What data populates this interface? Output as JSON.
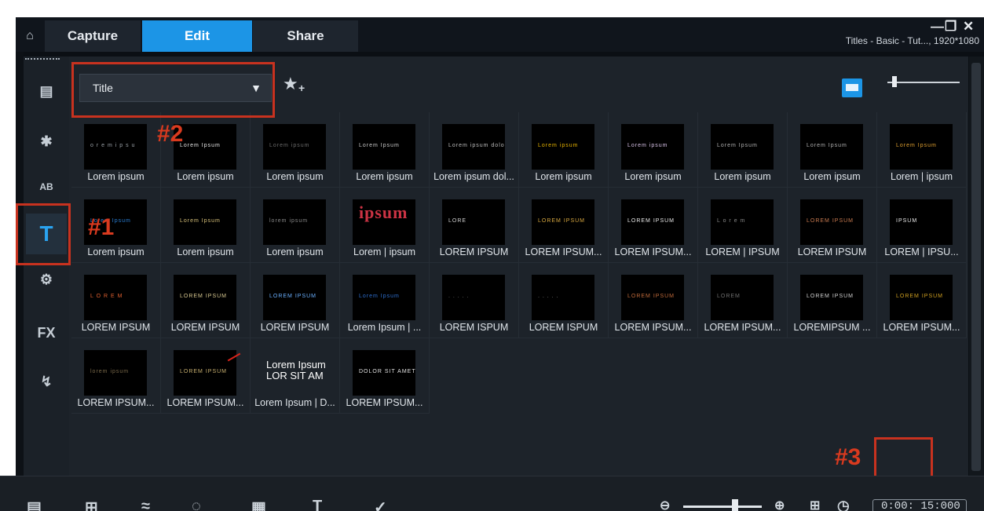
{
  "window": {
    "title": "Titles - Basic - Tut..., 1920*1080",
    "minimize_glyph": "—",
    "restore_glyph": "❐",
    "close_glyph": "✕"
  },
  "tabs": [
    {
      "label": "Capture"
    },
    {
      "label": "Edit",
      "active": true
    },
    {
      "label": "Share"
    }
  ],
  "sidebar": {
    "items": [
      {
        "name": "media-library-icon",
        "glyph": "▤"
      },
      {
        "name": "instant-project-icon",
        "glyph": "✱"
      },
      {
        "name": "transition-icon",
        "glyph": "AB"
      },
      {
        "name": "title-icon",
        "glyph": "T",
        "active": true
      },
      {
        "name": "graphics-icon",
        "glyph": "⚙"
      },
      {
        "name": "filter-icon",
        "glyph": "FX"
      },
      {
        "name": "path-icon",
        "glyph": "↯"
      }
    ]
  },
  "toolbar": {
    "category_value": "Title",
    "favorite_glyph": "★"
  },
  "colors": {
    "accent": "#1c95e6",
    "annotation_red": "#c8321f",
    "panel_bg": "#1d232a"
  },
  "annotations": {
    "label1": "#1",
    "label2": "#2",
    "label3": "#3"
  },
  "thumbnails": [
    {
      "caption": "Lorem ipsum",
      "art": "o r e m   i p s u",
      "color": "#9aa0a6"
    },
    {
      "caption": "Lorem ipsum",
      "art": "Lorem Ipsum",
      "color": "#e6e6e6"
    },
    {
      "caption": "Lorem ipsum",
      "art": "Lorem ipsum",
      "color": "#6b6b6b"
    },
    {
      "caption": "Lorem ipsum",
      "art": "Lorem Ipsum",
      "color": "#c9c9c9"
    },
    {
      "caption": "Lorem ipsum dol...",
      "art": "Lorem ipsum dolor sit",
      "color": "#bdbdbd"
    },
    {
      "caption": "Lorem ipsum",
      "art": "Lorem ipsum",
      "color": "#e8b400"
    },
    {
      "caption": "Lorem ipsum",
      "art": "Lorem ipsum",
      "color": "#d9c3e8"
    },
    {
      "caption": "Lorem ipsum",
      "art": "Lorem Ipsum",
      "color": "#b0b0b0"
    },
    {
      "caption": "Lorem ipsum",
      "art": "Lorem Ipsum",
      "color": "#b0b0b0"
    },
    {
      "caption": "Lorem | ipsum",
      "art": "Lorem Ipsum",
      "color": "#e0a030"
    },
    {
      "caption": "Lorem ipsum",
      "art": "Lorem Ipsum",
      "color": "#2a7fd6"
    },
    {
      "caption": "Lorem ipsum",
      "art": "Lorem Ipsum",
      "color": "#d9c27a"
    },
    {
      "caption": "Lorem ipsum",
      "art": "lorem ipsum",
      "color": "#8a8a8a"
    },
    {
      "caption": "Lorem | ipsum",
      "art": "ipsum",
      "color": "#cc3344"
    },
    {
      "caption": "LOREM IPSUM",
      "art": "LORE",
      "color": "#cfcfcf"
    },
    {
      "caption": "LOREM IPSUM...",
      "art": "LOREM IPSUM",
      "color": "#d8a840"
    },
    {
      "caption": "LOREM IPSUM...",
      "art": "LOREM IPSUM",
      "color": "#e8e8e8"
    },
    {
      "caption": "LOREM | IPSUM",
      "art": "L o r e m",
      "color": "#888888"
    },
    {
      "caption": "LOREM IPSUM",
      "art": "LOREM IPSUM",
      "color": "#c87a50"
    },
    {
      "caption": "LOREM | IPSU...",
      "art": "IPSUM",
      "color": "#e8e8e8"
    },
    {
      "caption": "LOREM IPSUM",
      "art": "L O R E M",
      "color": "#e06030"
    },
    {
      "caption": "LOREM IPSUM",
      "art": "LOREM IPSUM",
      "color": "#d8c890"
    },
    {
      "caption": "LOREM IPSUM",
      "art": "LOREM IPSUM",
      "color": "#6ab0ff"
    },
    {
      "caption": "Lorem Ipsum | ...",
      "art": "Lorem Ipsum",
      "color": "#2e6fd0"
    },
    {
      "caption": "LOREM ISPUM",
      "art": ". . . . .",
      "color": "#777777"
    },
    {
      "caption": "LOREM ISPUM",
      "art": ". . . . .",
      "color": "#888888"
    },
    {
      "caption": "LOREM IPSUM...",
      "art": "LOREM IPSUM",
      "color": "#c06a3a"
    },
    {
      "caption": "LOREM IPSUM...",
      "art": "LOREM",
      "color": "#707070"
    },
    {
      "caption": "LOREMIPSUM ...",
      "art": "LOREM IPSUM",
      "color": "#d0d0d0"
    },
    {
      "caption": "LOREM IPSUM...",
      "art": "LOREM IPSUM",
      "color": "#d0a020"
    },
    {
      "caption": "LOREM IPSUM...",
      "art": "lorem ipsum",
      "color": "#7a6a4a"
    },
    {
      "caption": "LOREM IPSUM...",
      "art": "LOREM IPSUM",
      "color": "#c8b070"
    },
    {
      "caption": "Lorem Ipsum | D...",
      "art": "Lorem Ipsum LOR SIT AM",
      "color": "#ffffff"
    },
    {
      "caption": "LOREM IPSUM...",
      "art": "DOLOR SIT AMET",
      "color": "#e0e0e0"
    }
  ],
  "bottom": {
    "timecode": "0:00: 15:000"
  }
}
